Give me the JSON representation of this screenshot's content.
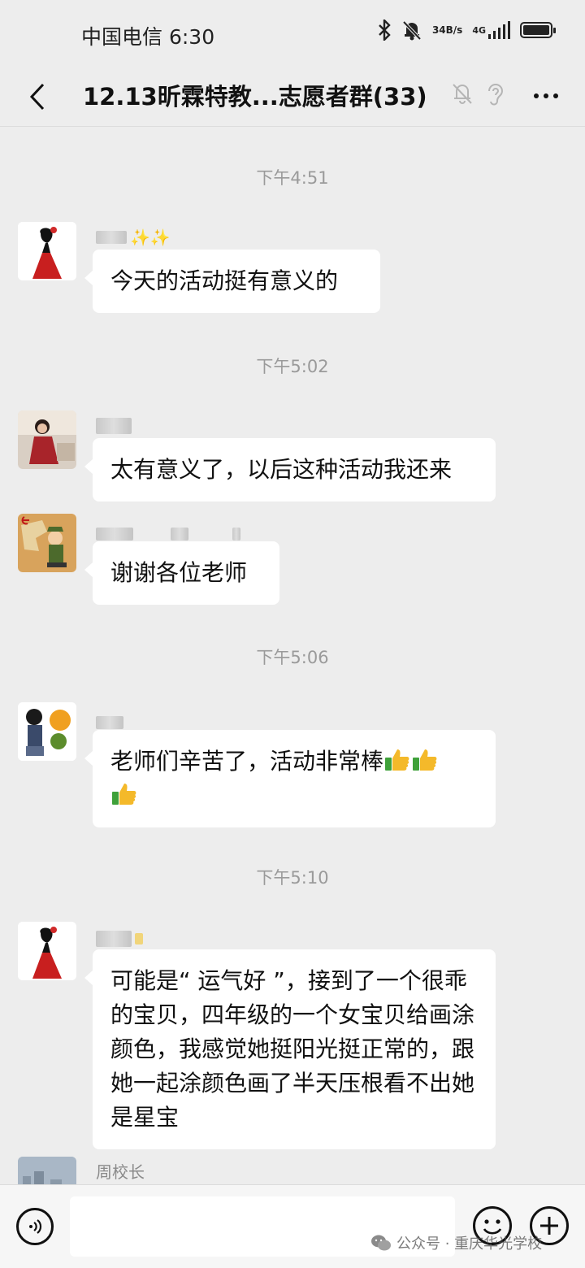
{
  "status_bar": {
    "carrier": "中国电信",
    "time": "6:30",
    "net_speed_value": "34",
    "net_speed_unit": "B/s",
    "network_type": "4G",
    "icons": [
      "bluetooth-icon",
      "mute-bell-icon",
      "signal-icon",
      "battery-icon"
    ]
  },
  "header": {
    "title": "12.13昕霖特教...志愿者群(33)",
    "icons": [
      "back-arrow-icon",
      "muted-notifications-icon",
      "earpiece-icon",
      "more-icon"
    ]
  },
  "chat": {
    "timestamps": [
      "下午4:51",
      "下午5:02",
      "下午5:06",
      "下午5:10"
    ],
    "messages": [
      {
        "text": "今天的活动挺有意义的",
        "avatar": "red-dress-woman-avatar",
        "sender_suffix": "✨✨"
      },
      {
        "text": "太有意义了，以后这种活动我还来",
        "avatar": "photo-woman-avatar"
      },
      {
        "text": "谢谢各位老师",
        "avatar": "soldier-cartoon-avatar"
      },
      {
        "text": "老师们辛苦了，活动非常棒",
        "avatar": "police-cartoon-avatar",
        "emoji": "thumbs-up-icon",
        "emoji_count": 3
      },
      {
        "text": "可能是“ 运气好 ”，接到了一个很乖的宝贝，四年级的一个女宝贝给画涂颜色，我感觉她挺阳光挺正常的，跟她一起涂颜色画了半天压根看不出她是星宝",
        "avatar": "red-dress-woman-avatar"
      }
    ],
    "partial_sender": "周校长"
  },
  "input_bar": {
    "placeholder": "",
    "icons": [
      "voice-icon",
      "emoji-icon",
      "plus-icon"
    ]
  },
  "watermark": {
    "text": "公众号 · 重庆华光学校"
  },
  "colors": {
    "background": "#ededed",
    "bubble": "#ffffff",
    "timestamp": "#9a9a9a"
  }
}
